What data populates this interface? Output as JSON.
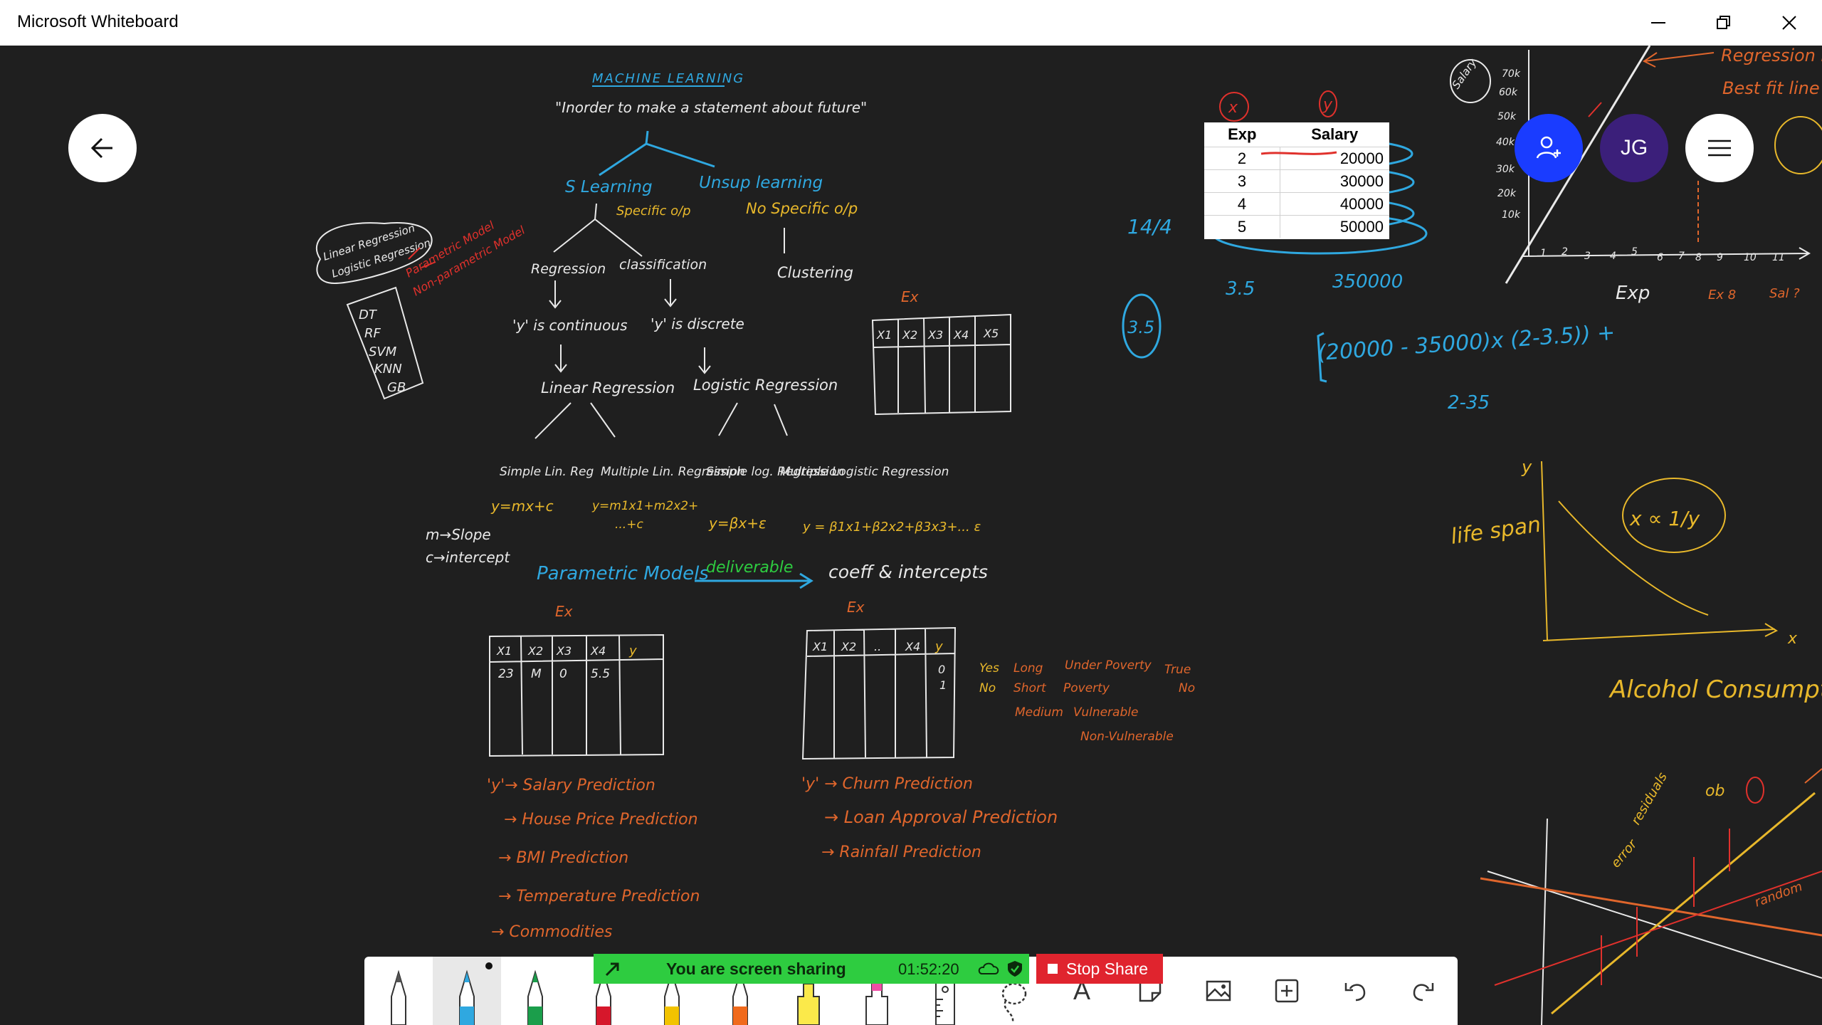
{
  "window": {
    "title": "Microsoft Whiteboard"
  },
  "colors": {
    "canvas": "#1f1f1f",
    "ink_white": "#e9e9e9",
    "ink_blue": "#2fa8e0",
    "ink_yellow": "#e8b82b",
    "ink_orange": "#e0662c",
    "ink_red": "#e0312c",
    "invite_button": "#1a3cff",
    "avatar": "#3b1f7a",
    "share_green": "#2ecc40",
    "stop_red": "#e0242e"
  },
  "header": {
    "avatar_initials": "JG"
  },
  "ink": {
    "title": "MACHINE LEARNING",
    "quote": "\"Inorder to make a statement about future\"",
    "s_learning": "S Learning",
    "specific_op": "Specific o/p",
    "unsup_learning": "Unsup learning",
    "no_specific_op": "No Specific o/p",
    "regression": "Regression",
    "classification": "classification",
    "clustering": "Clustering",
    "y_continuous": "'y' is continuous",
    "y_discrete": "'y' is discrete",
    "linear_regression": "Linear Regression",
    "logistic_regression": "Logistic Regression",
    "simple_lin_reg": "Simple Lin. Reg",
    "multiple_lin_reg": "Multiple Lin. Regression",
    "simple_log_reg": "Simple log. Regression",
    "multiple_log_reg": "Multiple Logistic Regression",
    "eq_simple": "y=mx+c",
    "eq_multi_line1": "y=m1x1+m2x2+",
    "eq_multi_line2": "...+c",
    "eq_log": "y=βx+ε",
    "eq_multi_log": "y = β1x1+β2x2+β3x3+... ε",
    "m_slope": "m→Slope",
    "c_intercept": "c→intercept",
    "parametric_models": "Parametric Models",
    "deliverable": "deliverable",
    "coeff_intercepts": "coeff & intercepts",
    "left_box_line1": "Linear Regression",
    "left_box_line2": "Logistic Regression",
    "parametric_model": "Parametric Model",
    "non_parametric_model": "Non-parametric Model",
    "algos": [
      "DT",
      "RF",
      "SVM",
      "KNN",
      "GB"
    ],
    "ex_label": "Ex",
    "table1_headers": [
      "X1",
      "X2",
      "X3",
      "X4",
      "y"
    ],
    "table1_row": [
      "23",
      "M",
      "0",
      "5.5",
      ""
    ],
    "table2_headers": [
      "X1",
      "X2",
      "..",
      "X4",
      "y"
    ],
    "table2_y": [
      "0",
      "1"
    ],
    "table3_headers": [
      "X1",
      "X2",
      "X3",
      "X4",
      "X5"
    ],
    "cat_col1": [
      "Yes",
      "No"
    ],
    "cat_col2": [
      "Long",
      "Short",
      "Medium"
    ],
    "cat_col3": [
      "Under Poverty",
      "Poverty",
      "Vulnerable",
      "Non-Vulnerable"
    ],
    "cat_col4": [
      "True",
      "No"
    ],
    "preds_left": [
      "'y'→ Salary Prediction",
      "→ House Price Prediction",
      "→ BMI Prediction",
      "→ Temperature Prediction",
      "→ Commodities"
    ],
    "preds_right": [
      "'y' → Churn Prediction",
      "→ Loan Approval Prediction",
      "→ Rainfall Prediction"
    ],
    "frac": "14/4",
    "circled_35": "3.5",
    "under_35": "3.5",
    "under_350000": "350000",
    "formula": "(20000 - 35000)x (2-3.5)) +",
    "formula_sub": "2-35",
    "x_mark": "x",
    "y_mark": "y",
    "regression_line": "Regression Line",
    "best_fit": "Best fit line",
    "salary_axis": "Salary",
    "exp_axis": "Exp",
    "y_ticks": [
      "70k",
      "60k",
      "50k",
      "40k",
      "30k",
      "20k",
      "10k"
    ],
    "x_ticks": [
      "1",
      "2",
      "3",
      "4",
      "5",
      "6",
      "7",
      "8",
      "9",
      "10",
      "11"
    ],
    "ex8": "Ex 8",
    "sal_q": "Sal ?",
    "life_span": "life span",
    "x_alpha": "x ∝ 1/y",
    "alcohol": "Alcohol Consumption",
    "axis_y": "y",
    "axis_x": "x",
    "br_labels": [
      "ob",
      "residuals",
      "error",
      "random"
    ]
  },
  "pasted_table": {
    "headers": [
      "Exp",
      "Salary"
    ],
    "rows": [
      [
        "2",
        "20000"
      ],
      [
        "3",
        "30000"
      ],
      [
        "4",
        "40000"
      ],
      [
        "5",
        "50000"
      ]
    ]
  },
  "share": {
    "status": "You are screen sharing",
    "timer": "01:52:20",
    "stop_label": "Stop Share"
  },
  "toolbar": {
    "tools": [
      "pen-white",
      "pen-blue",
      "pen-green",
      "pen-red",
      "pen-yellow",
      "pen-orange",
      "highlighter-yellow",
      "highlighter-pink",
      "ruler",
      "lasso",
      "text",
      "sticky-note",
      "image",
      "add",
      "undo",
      "redo"
    ],
    "text_tool_glyph": "A"
  }
}
